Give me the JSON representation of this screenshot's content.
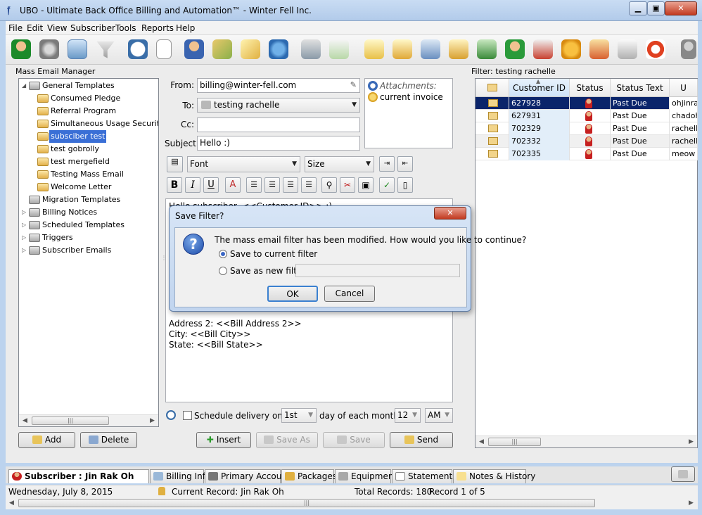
{
  "window": {
    "title": "UBO - Ultimate Back Office Billing and Automation™  - Winter Fell Inc."
  },
  "menu": [
    "File",
    "Edit",
    "View",
    "Subscriber",
    "Tools",
    "Reports",
    "Help"
  ],
  "left_panel": {
    "title": "Mass Email Manager",
    "tree": [
      {
        "label": "General Templates",
        "level": 0,
        "expanded": true
      },
      {
        "label": "Consumed Pledge",
        "level": 1
      },
      {
        "label": "Referral Program",
        "level": 1
      },
      {
        "label": "Simultaneous Usage Security Alert",
        "level": 1
      },
      {
        "label": "subsciber test",
        "level": 1,
        "selected": true
      },
      {
        "label": "test gobrolly",
        "level": 1
      },
      {
        "label": "test mergefield",
        "level": 1
      },
      {
        "label": "Testing Mass Email",
        "level": 1
      },
      {
        "label": "Welcome Letter",
        "level": 1
      },
      {
        "label": "Migration Templates",
        "level": 0
      },
      {
        "label": "Billing Notices",
        "level": 0,
        "collapsed": true
      },
      {
        "label": "Scheduled Templates",
        "level": 0,
        "collapsed": true
      },
      {
        "label": "Triggers",
        "level": 0,
        "collapsed": true
      },
      {
        "label": "Subscriber Emails",
        "level": 0,
        "collapsed": true
      }
    ],
    "add_label": "Add",
    "delete_label": "Delete"
  },
  "email": {
    "from_label": "From:",
    "from_value": "billing@winter-fell.com",
    "to_label": "To:",
    "to_value": "testing rachelle",
    "cc_label": "Cc:",
    "cc_value": "",
    "subject_label": "Subject:",
    "subject_value": "Hello :)",
    "attachments_label": "Attachments:",
    "attachment_item": "current invoice",
    "font_placeholder": "Font",
    "size_placeholder": "Size",
    "body_lines": [
      "Hello subscriber, <<Customer ID>> :)",
      "Address 2: <<Bill Address 2>>",
      "City: <<Bill City>>",
      "State: <<Bill State>>"
    ],
    "schedule_label": "Schedule delivery on the",
    "schedule_day": "1st",
    "schedule_mid": "day of each month at",
    "schedule_hour": "12",
    "schedule_ampm": "AM",
    "insert_label": "Insert",
    "save_as_label": "Save As",
    "save_label": "Save",
    "send_label": "Send"
  },
  "filter_panel": {
    "title": "Filter: testing rachelle",
    "columns": [
      "",
      "Customer ID",
      "Status",
      "Status Text",
      "U"
    ],
    "rows": [
      {
        "id": "627928",
        "status_text": "Past Due",
        "user": "ohjinrak",
        "selected": true,
        "check": true
      },
      {
        "id": "627931",
        "status_text": "Past Due",
        "user": "chadohv",
        "check": false
      },
      {
        "id": "702329",
        "status_text": "Past Due",
        "user": "rachelle_",
        "check": true
      },
      {
        "id": "702332",
        "status_text": "Past Due",
        "user": "rachelle_",
        "check": true
      },
      {
        "id": "702335",
        "status_text": "Past Due",
        "user": "meow",
        "check": false
      }
    ]
  },
  "bottom_tabs": {
    "subscriber_label": "Subscriber : Jin Rak Oh",
    "tabs": [
      "Billing Info",
      "Primary Account",
      "Packages",
      "Equipment",
      "Statements",
      "Notes & History"
    ]
  },
  "status": {
    "date": "Wednesday, July 8, 2015",
    "current_record": "Current Record: Jin Rak Oh",
    "total_records": "Total Records: 180",
    "record_of": "Record 1 of 5"
  },
  "dialog": {
    "title": "Save Filter?",
    "message": "The mass email filter has been modified. How would you like to continue?",
    "option_current": "Save to current filter",
    "option_new": "Save as new filter",
    "new_filter_value": "",
    "ok_label": "OK",
    "cancel_label": "Cancel"
  }
}
